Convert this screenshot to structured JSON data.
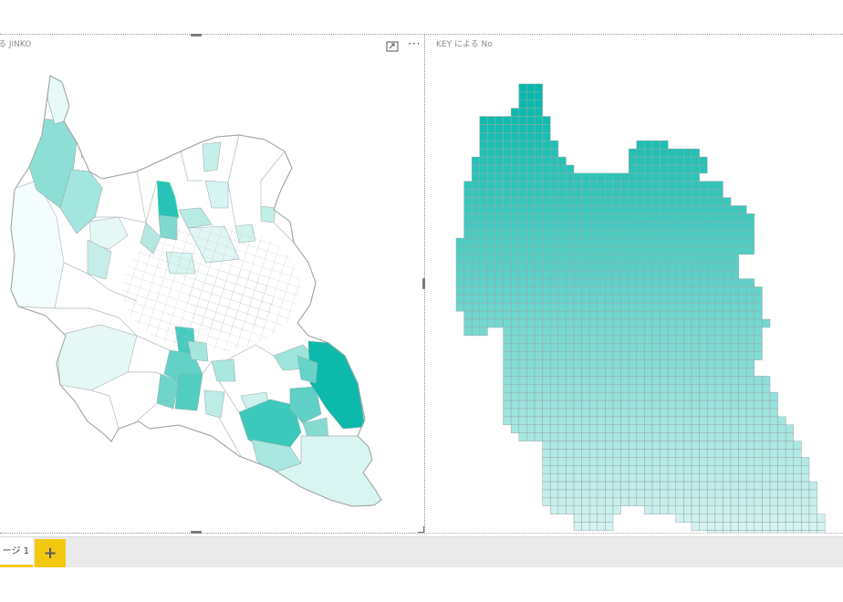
{
  "visuals": {
    "left": {
      "title": "る JINKO"
    },
    "right": {
      "title": "KEY による No"
    }
  },
  "tabs": [
    {
      "label": "ージ 1",
      "active": true
    }
  ],
  "add_tab_label": "+",
  "more_label": "···",
  "colors": {
    "accent": "#01b8aa",
    "tab_accent": "#f2c811",
    "low": "#ffffff",
    "high": "#01b8aa",
    "border": "#9aa8a8"
  },
  "icons": {
    "focus": "focus-mode-icon",
    "more": "more-options-icon",
    "add": "plus-icon"
  }
}
